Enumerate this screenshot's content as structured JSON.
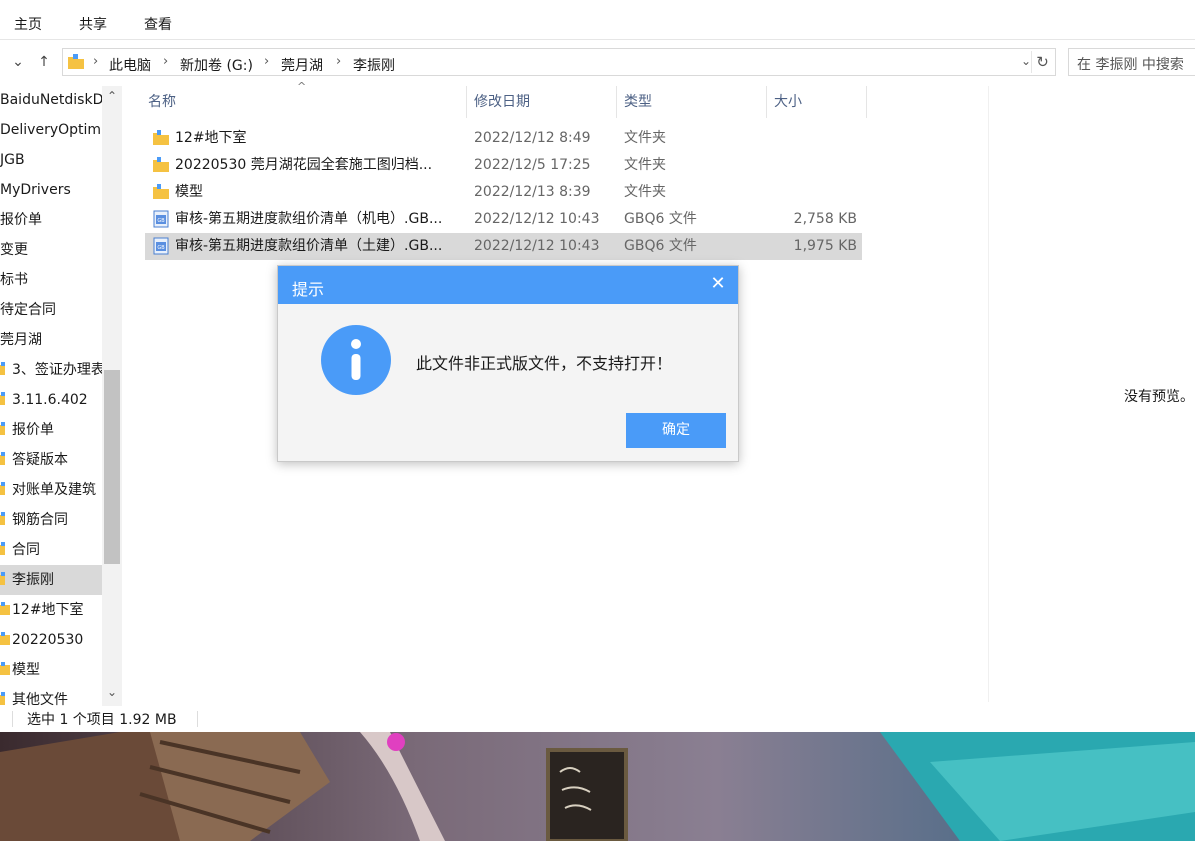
{
  "ribbon": {
    "tabs": [
      "主页",
      "共享",
      "查看"
    ]
  },
  "address": {
    "crumbs": [
      "此电脑",
      "新加卷 (G:)",
      "莞月湖",
      "李振刚"
    ],
    "search_placeholder": "在 李振刚 中搜索"
  },
  "sidebar": {
    "items": [
      {
        "label": "BaiduNetdiskD",
        "icon": "none"
      },
      {
        "label": "DeliveryOptim",
        "icon": "none"
      },
      {
        "label": "JGB",
        "icon": "none"
      },
      {
        "label": "MyDrivers",
        "icon": "none"
      },
      {
        "label": "报价单",
        "icon": "none"
      },
      {
        "label": "变更",
        "icon": "none"
      },
      {
        "label": "标书",
        "icon": "none"
      },
      {
        "label": "待定合同",
        "icon": "none"
      },
      {
        "label": "莞月湖",
        "icon": "none"
      },
      {
        "label": "3、签证办理表",
        "icon": "pin"
      },
      {
        "label": "3.11.6.402",
        "icon": "pin"
      },
      {
        "label": "报价单",
        "icon": "pin"
      },
      {
        "label": "答疑版本",
        "icon": "pin"
      },
      {
        "label": "对账单及建筑",
        "icon": "pin"
      },
      {
        "label": "钢筋合同",
        "icon": "pin"
      },
      {
        "label": "合同",
        "icon": "pin"
      },
      {
        "label": "李振刚",
        "icon": "pin",
        "selected": true
      },
      {
        "label": "12#地下室",
        "icon": "folder"
      },
      {
        "label": "20220530",
        "icon": "folder"
      },
      {
        "label": "模型",
        "icon": "folder"
      },
      {
        "label": "其他文件",
        "icon": "pin"
      }
    ]
  },
  "columns": {
    "name": "名称",
    "date": "修改日期",
    "type": "类型",
    "size": "大小"
  },
  "files": [
    {
      "name": "12#地下室",
      "date": "2022/12/12 8:49",
      "type": "文件夹",
      "size": "",
      "icon": "folder-icon"
    },
    {
      "name": "20220530  莞月湖花园全套施工图归档...",
      "date": "2022/12/5 17:25",
      "type": "文件夹",
      "size": "",
      "icon": "folder-icon"
    },
    {
      "name": "模型",
      "date": "2022/12/13 8:39",
      "type": "文件夹",
      "size": "",
      "icon": "folder-icon"
    },
    {
      "name": "审核-第五期进度款组价清单（机电）.GB...",
      "date": "2022/12/12 10:43",
      "type": "GBQ6 文件",
      "size": "2,758 KB",
      "icon": "gbq-file-icon"
    },
    {
      "name": "审核-第五期进度款组价清单（土建）.GB...",
      "date": "2022/12/12 10:43",
      "type": "GBQ6 文件",
      "size": "1,975 KB",
      "icon": "gbq-file-icon",
      "selected": true
    }
  ],
  "preview": {
    "empty_text": "没有预览。"
  },
  "status": {
    "text": "选中 1 个项目  1.92 MB"
  },
  "dialog": {
    "title": "提示",
    "close_glyph": "✕",
    "message": "此文件非正式版文件，不支持打开！",
    "ok_label": "确定",
    "icon": "info-icon"
  },
  "colors": {
    "accent": "#4a9bf8",
    "selection": "#d9d9d9",
    "folder": "#f5c242"
  }
}
